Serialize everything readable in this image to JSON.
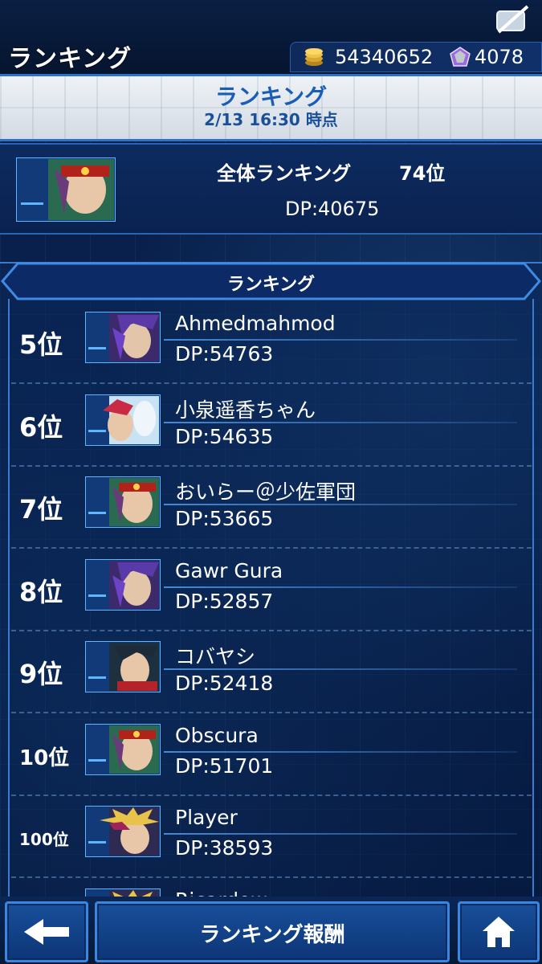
{
  "header": {
    "title": "ランキング",
    "coins": "54340652",
    "gems": "4078"
  },
  "banner": {
    "title": "ランキング",
    "timestamp": "2/13 16:30 時点"
  },
  "my_ranking": {
    "label": "全体ランキング",
    "rank": "74位",
    "dp": "DP:40675"
  },
  "list": {
    "header": "ランキング",
    "rows": [
      {
        "rank": "5位",
        "name": "Ahmedmahmod",
        "dp": "DP:54763",
        "avatar": "purple-hair"
      },
      {
        "rank": "6位",
        "name": "小泉遥香ちゃん",
        "dp": "DP:54635",
        "avatar": "red-hair"
      },
      {
        "rank": "7位",
        "name": "おいらー＠少佐軍団",
        "dp": "DP:53665",
        "avatar": "red-cap"
      },
      {
        "rank": "8位",
        "name": "Gawr Gura",
        "dp": "DP:52857",
        "avatar": "purple-hair"
      },
      {
        "rank": "9位",
        "name": "コバヤシ",
        "dp": "DP:52418",
        "avatar": "dark-hair"
      },
      {
        "rank": "10位",
        "name": "Obscura",
        "dp": "DP:51701",
        "avatar": "red-cap"
      },
      {
        "rank": "100位",
        "name": "Player",
        "dp": "DP:38593",
        "avatar": "spiky-hair"
      },
      {
        "rank": "",
        "name": "Ricardow",
        "dp": "",
        "avatar": "spiky-hair"
      }
    ]
  },
  "footer": {
    "reward_label": "ランキング報酬"
  },
  "colors": {
    "accent": "#3b86e0",
    "banner_text": "#1a5db5",
    "background": "#082049"
  }
}
